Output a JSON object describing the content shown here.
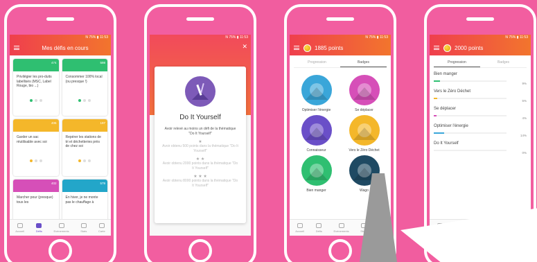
{
  "status": "N  75% ▮ 11:53",
  "tabs": [
    "Accueil",
    "Défis",
    "Evènements",
    "Stats",
    "Carte"
  ],
  "screen1": {
    "title": "Mes défis en cours",
    "cards": [
      {
        "count": "474",
        "text": "Privilégier les pro-duits labellisés (MSC, Label Rouge, bio ...)",
        "color": "#2fbf71"
      },
      {
        "count": "598",
        "text": "Consommer 100% local (ou presque !)",
        "color": "#2fbf71"
      },
      {
        "count": "406",
        "text": "Garder un sac réutilisable avec soi",
        "color": "#f4b72a"
      },
      {
        "count": "197",
        "text": "Repérer les stations de tri et déchetteries près de chez soi",
        "color": "#f4b72a"
      },
      {
        "count": "402",
        "text": "Marcher pour (presque) tous les",
        "color": "#d64fb8"
      },
      {
        "count": "579",
        "text": "En hiver, je ne monte pas le chauffage à",
        "color": "#23a6c9"
      }
    ]
  },
  "screen2": {
    "badge_title": "Do It Yourself",
    "main": "Avoir relevé au moins un défi de la thématique \"Do It Yourself\"",
    "levels": [
      {
        "stars": "★",
        "text": "Avoir obtenu 500 points dans la thématique \"Do It Yourself\""
      },
      {
        "stars": "★ ★",
        "text": "Avoir obtenu 2000 points dans la thématique \"Do It Yourself\""
      },
      {
        "stars": "★ ★ ★",
        "text": "Avoir obtenu 8000 points dans la thématique \"Do It Yourself\""
      }
    ]
  },
  "screen3": {
    "points": "1885 points",
    "seg": [
      "Progression",
      "Badges"
    ],
    "badges": [
      {
        "label": "Optimiser l'énergie",
        "color": "#3aa6d9"
      },
      {
        "label": "Se déplacer",
        "color": "#d64fb8"
      },
      {
        "label": "Connaisseur",
        "color": "#6a4fc8"
      },
      {
        "label": "Vers le Zéro Déchet",
        "color": "#f4b72a"
      },
      {
        "label": "Bien manger",
        "color": "#2fbf71"
      },
      {
        "label": "Wago",
        "color": "#1f4a63"
      }
    ]
  },
  "screen4": {
    "points": "2000 points",
    "seg": [
      "Progression",
      "Badges"
    ],
    "rows": [
      {
        "label": "Bien manger",
        "pct": "9%",
        "fill": 0.09,
        "color": "#2fbf71"
      },
      {
        "label": "Vers le Zéro Déchet",
        "pct": "5%",
        "fill": 0.05,
        "color": "#f4b72a"
      },
      {
        "label": "Se déplacer",
        "pct": "4%",
        "fill": 0.04,
        "color": "#d64fb8"
      },
      {
        "label": "Optimiser l'énergie",
        "pct": "14%",
        "fill": 0.14,
        "color": "#3aa6d9"
      },
      {
        "label": "Do It Yourself",
        "pct": "0%",
        "fill": 0.0,
        "color": "#7d5ab8"
      }
    ]
  }
}
